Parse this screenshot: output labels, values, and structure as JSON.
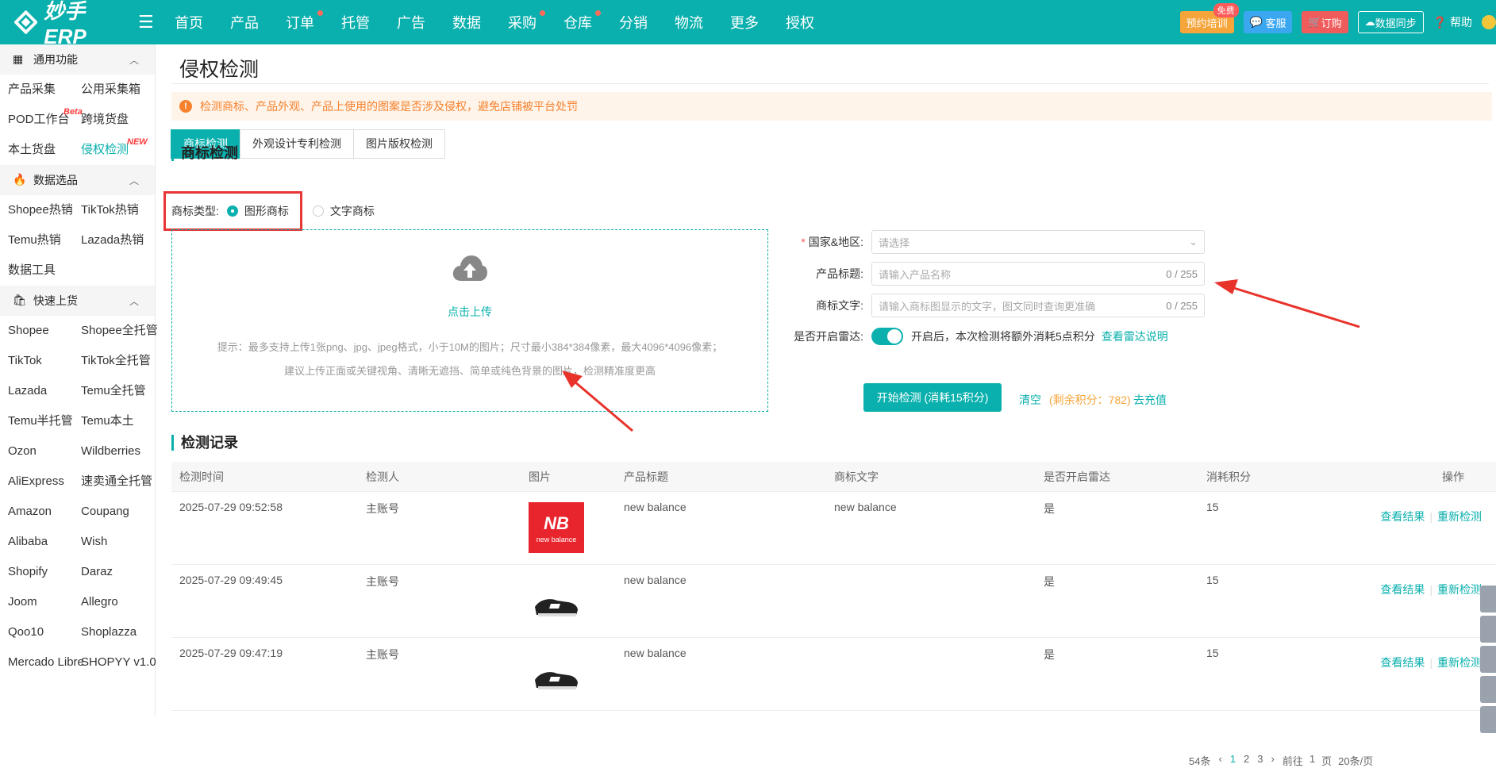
{
  "app": {
    "logo_text": "妙手ERP"
  },
  "topnav": [
    {
      "label": "首页",
      "dot": false
    },
    {
      "label": "产品",
      "dot": false
    },
    {
      "label": "订单",
      "dot": true
    },
    {
      "label": "托管",
      "dot": false
    },
    {
      "label": "广告",
      "dot": false
    },
    {
      "label": "数据",
      "dot": false
    },
    {
      "label": "采购",
      "dot": true
    },
    {
      "label": "仓库",
      "dot": true
    },
    {
      "label": "分销",
      "dot": false
    },
    {
      "label": "物流",
      "dot": false
    },
    {
      "label": "更多",
      "dot": false
    },
    {
      "label": "授权",
      "dot": false
    }
  ],
  "topright": {
    "train": "预约培训",
    "free": "免费",
    "kefu": "客服",
    "buy": "订购",
    "sync": "数据同步",
    "help": "帮助"
  },
  "sidebar": {
    "sections": [
      {
        "title": "通用功能",
        "items": [
          "产品采集",
          "公用采集箱",
          "POD工作台",
          "跨境货盘",
          "本土货盘",
          "侵权检测"
        ]
      },
      {
        "title": "数据选品",
        "items": [
          "Shopee热销",
          "TikTok热销",
          "Temu热销",
          "Lazada热销",
          "数据工具"
        ]
      },
      {
        "title": "快速上货",
        "items": [
          "Shopee",
          "Shopee全托管",
          "TikTok",
          "TikTok全托管",
          "Lazada",
          "Temu全托管",
          "Temu半托管",
          "Temu本土",
          "Ozon",
          "Wildberries",
          "AliExpress",
          "速卖通全托管",
          "Amazon",
          "Coupang",
          "Alibaba",
          "Wish",
          "Shopify",
          "Daraz",
          "Joom",
          "Allegro",
          "Qoo10",
          "Shoplazza",
          "Mercado Libre",
          "SHOPYY v1.0"
        ]
      }
    ],
    "badges": {
      "pod": "Beta",
      "infringe": "NEW"
    }
  },
  "page": {
    "title": "侵权检测",
    "notice": "检测商标、产品外观、产品上使用的图案是否涉及侵权，避免店铺被平台处罚",
    "tabs": [
      "商标检测",
      "外观设计专利检测",
      "图片版权检测"
    ],
    "section_title": "商标检测",
    "type_label": "商标类型:",
    "type_options": [
      "图形商标",
      "文字商标"
    ],
    "upload": {
      "label": "点击上传",
      "tip1": "提示：最多支持上传1张png、jpg、jpeg格式，小于10M的图片；尺寸最小384*384像素，最大4096*4096像素；",
      "tip2": "建议上传正面或关键视角、清晰无遮挡、简单或纯色背景的图片，检测精准度更高"
    },
    "form": {
      "country_label": "国家&地区:",
      "country_placeholder": "请选择",
      "title_label": "产品标题:",
      "title_placeholder": "请输入产品名称",
      "title_count": "0 / 255",
      "text_label": "商标文字:",
      "text_placeholder": "请输入商标图显示的文字，图文同时查询更准确",
      "text_count": "0 / 255",
      "radar_label": "是否开启雷达:",
      "radar_desc": "开启后，本次检测将额外消耗5点积分",
      "radar_link": "查看雷达说明"
    },
    "start_button": "开始检测 (消耗15积分)",
    "clear": "清空",
    "points": "(剩余积分：782)",
    "recharge": "去充值",
    "records_title": "检测记录"
  },
  "table": {
    "headers": [
      "检测时间",
      "检测人",
      "图片",
      "产品标题",
      "商标文字",
      "是否开启雷达",
      "消耗积分",
      "操作"
    ],
    "rows": [
      {
        "time": "2025-07-29 09:52:58",
        "user": "主账号",
        "title": "new balance",
        "text": "new balance",
        "radar": "是",
        "points": "15",
        "view": "查看结果",
        "redo": "重新检测"
      },
      {
        "time": "2025-07-29 09:49:45",
        "user": "主账号",
        "title": "new balance",
        "text": "",
        "radar": "是",
        "points": "15",
        "view": "查看结果",
        "redo": "重新检测"
      },
      {
        "time": "2025-07-29 09:47:19",
        "user": "主账号",
        "title": "new balance",
        "text": "",
        "radar": "是",
        "points": "15",
        "view": "查看结果",
        "redo": "重新检测"
      }
    ]
  },
  "pager": {
    "total": "54条",
    "pages": [
      "1",
      "2",
      "3"
    ],
    "goto": "前往",
    "page_input": "1",
    "page_unit": "页",
    "size": "20条/页"
  },
  "colors": {
    "primary": "#0ab0ad",
    "alert": "#e83535"
  }
}
